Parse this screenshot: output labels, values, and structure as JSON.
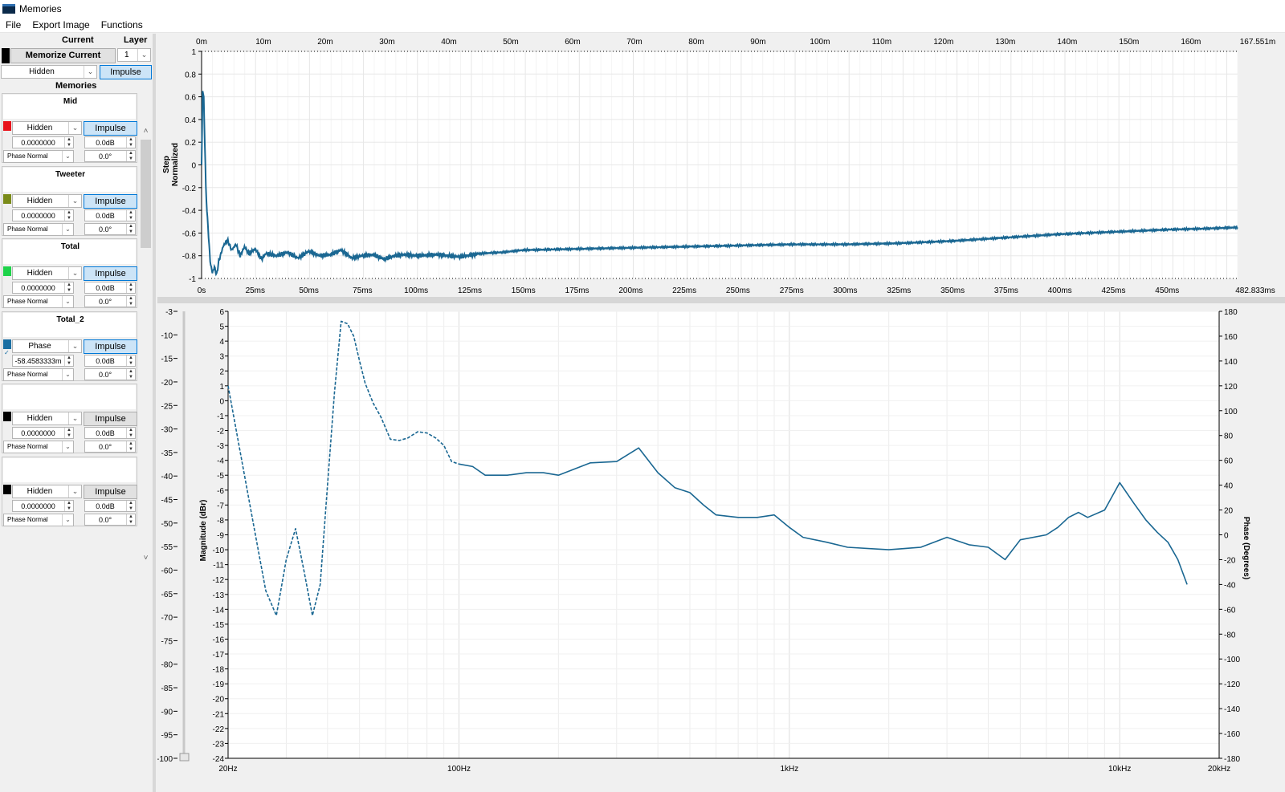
{
  "window": {
    "title": "Memories"
  },
  "menu": [
    "File",
    "Export Image",
    "Functions"
  ],
  "current": {
    "header_current": "Current",
    "header_layer": "Layer",
    "memorize_label": "Memorize Current",
    "layer_value": "1",
    "visibility": "Hidden",
    "mode_button": "Impulse",
    "swatch_color": "#000000"
  },
  "memories_header": "Memories",
  "memories": [
    {
      "name": "Mid",
      "color": "#e8131b",
      "visibility": "Hidden",
      "mode": "Impulse",
      "mode_active": true,
      "delay": "0.0000000",
      "gain": "0.0dB",
      "polarity": "Phase Normal",
      "phase": "0.0°"
    },
    {
      "name": "Tweeter",
      "color": "#7a8b19",
      "visibility": "Hidden",
      "mode": "Impulse",
      "mode_active": true,
      "delay": "0.0000000",
      "gain": "0.0dB",
      "polarity": "Phase Normal",
      "phase": "0.0°"
    },
    {
      "name": "Total",
      "color": "#1ed34a",
      "visibility": "Hidden",
      "mode": "Impulse",
      "mode_active": true,
      "delay": "0.0000000",
      "gain": "0.0dB",
      "polarity": "Phase Normal",
      "phase": "0.0°"
    },
    {
      "name": "Total_2",
      "color": "#1a6fa3",
      "visibility": "Phase",
      "mode": "Impulse",
      "mode_active": true,
      "delay": "-58.4583333m",
      "gain": "0.0dB",
      "polarity": "Phase Normal",
      "phase": "0.0°",
      "checked": true
    },
    {
      "name": "",
      "color": "#000000",
      "visibility": "Hidden",
      "mode": "Impulse",
      "mode_active": false,
      "delay": "0.0000000",
      "gain": "0.0dB",
      "polarity": "Phase Normal",
      "phase": "0.0°"
    },
    {
      "name": "",
      "color": "#000000",
      "visibility": "Hidden",
      "mode": "Impulse",
      "mode_active": false,
      "delay": "0.0000000",
      "gain": "0.0dB",
      "polarity": "Phase Normal",
      "phase": "0.0°"
    }
  ],
  "trace_color": "#1a6792",
  "chart_data": [
    {
      "type": "line",
      "ylabel": "Step Normalized",
      "ylim": [
        -1,
        1
      ],
      "yticks": [
        "1",
        "0.8",
        "0.6",
        "0.4",
        "0.2",
        "0",
        "-0.2",
        "-0.4",
        "-0.6",
        "-0.8",
        "-1"
      ],
      "xlim_ms": [
        0,
        482.833
      ],
      "top_axis_ticks": [
        "0m",
        "10m",
        "20m",
        "30m",
        "40m",
        "50m",
        "60m",
        "70m",
        "80m",
        "90m",
        "100m",
        "110m",
        "120m",
        "130m",
        "140m",
        "150m",
        "160m",
        "167.551m"
      ],
      "bottom_axis_ticks": [
        "0s",
        "25ms",
        "50ms",
        "75ms",
        "100ms",
        "125ms",
        "150ms",
        "175ms",
        "200ms",
        "225ms",
        "250ms",
        "275ms",
        "300ms",
        "325ms",
        "350ms",
        "375ms",
        "400ms",
        "425ms",
        "450ms",
        "482.833ms"
      ],
      "series": [
        {
          "x_ms": [
            0,
            0.5,
            1,
            1.5,
            2,
            2.5,
            3,
            4,
            5,
            6,
            7,
            8,
            10,
            12,
            14,
            16,
            18,
            20,
            22,
            25,
            28,
            30,
            35,
            40,
            45,
            50,
            55,
            60,
            65,
            70,
            75,
            80,
            85,
            90,
            95,
            100,
            110,
            120,
            130,
            140,
            150,
            175,
            200,
            225,
            250,
            275,
            300,
            325,
            350,
            375,
            400,
            425,
            450,
            470,
            482.8
          ],
          "y": [
            0.0,
            0.65,
            0.6,
            0.2,
            -0.2,
            -0.4,
            -0.55,
            -0.85,
            -0.95,
            -0.9,
            -0.97,
            -0.85,
            -0.72,
            -0.66,
            -0.75,
            -0.7,
            -0.8,
            -0.72,
            -0.78,
            -0.74,
            -0.83,
            -0.78,
            -0.8,
            -0.77,
            -0.82,
            -0.76,
            -0.8,
            -0.79,
            -0.75,
            -0.82,
            -0.8,
            -0.79,
            -0.83,
            -0.8,
            -0.79,
            -0.8,
            -0.79,
            -0.81,
            -0.78,
            -0.77,
            -0.75,
            -0.74,
            -0.73,
            -0.72,
            -0.71,
            -0.7,
            -0.7,
            -0.69,
            -0.67,
            -0.64,
            -0.61,
            -0.59,
            -0.57,
            -0.56,
            -0.55
          ]
        }
      ]
    },
    {
      "type": "line",
      "ylabel": "Magnitude (dBr)",
      "y2label": "Phase (Degrees)",
      "xscale": "log",
      "xlim": [
        20,
        20000
      ],
      "xticks": [
        "20Hz",
        "100Hz",
        "1kHz",
        "10kHz",
        "20kHz"
      ],
      "outer_left_ticks": [
        "-3",
        "-10",
        "-15",
        "-20",
        "-25",
        "-30",
        "-35",
        "-40",
        "-45",
        "-50",
        "-55",
        "-60",
        "-65",
        "-70",
        "-75",
        "-80",
        "-85",
        "-90",
        "-95",
        "-100"
      ],
      "left_ticks": [
        "6",
        "5",
        "4",
        "3",
        "2",
        "1",
        "0",
        "-1",
        "-2",
        "-3",
        "-4",
        "-5",
        "-6",
        "-7",
        "-8",
        "-9",
        "-10",
        "-11",
        "-12",
        "-13",
        "-14",
        "-15",
        "-16",
        "-17",
        "-18",
        "-19",
        "-20",
        "-21",
        "-22",
        "-23",
        "-24"
      ],
      "right_ticks": [
        "180",
        "160",
        "140",
        "120",
        "100",
        "80",
        "60",
        "40",
        "20",
        "0",
        "-20",
        "-40",
        "-60",
        "-80",
        "-100",
        "-120",
        "-140",
        "-160",
        "-180"
      ],
      "y2lim": [
        -180,
        180
      ],
      "series": [
        {
          "name": "Phase",
          "freq_hz": [
            20,
            22,
            24,
            26,
            28,
            30,
            32,
            34,
            36,
            38,
            40,
            42,
            44,
            46,
            48,
            50,
            52,
            55,
            58,
            62,
            66,
            70,
            75,
            80,
            85,
            90,
            95,
            100,
            110,
            120,
            130,
            140,
            160,
            180,
            200,
            250,
            300,
            350,
            400,
            450,
            500,
            550,
            600,
            700,
            800,
            900,
            1000,
            1100,
            1300,
            1500,
            2000,
            2500,
            3000,
            3500,
            4000,
            4500,
            5000,
            6000,
            6500,
            7000,
            7500,
            8000,
            9000,
            10000,
            11000,
            12000,
            13000,
            14000,
            15000,
            16000,
            17000,
            18000,
            19000,
            20000
          ],
          "phase_deg": [
            120,
            60,
            5,
            -45,
            -65,
            -20,
            5,
            -30,
            -65,
            -40,
            40,
            115,
            172,
            170,
            160,
            140,
            122,
            106,
            95,
            77,
            76,
            78,
            83,
            82,
            78,
            72,
            59,
            57,
            55,
            48,
            48,
            48,
            50,
            50,
            48,
            58,
            59,
            70,
            50,
            38,
            34,
            24,
            16,
            14,
            14,
            16,
            6,
            -2,
            -6,
            -10,
            -12,
            -10,
            -2,
            -8,
            -10,
            -20,
            -4,
            0,
            6,
            14,
            18,
            14,
            20,
            42,
            26,
            12,
            2,
            -6,
            -20,
            -40
          ],
          "line_style": "dashed below 100Hz, solid above"
        }
      ]
    }
  ]
}
